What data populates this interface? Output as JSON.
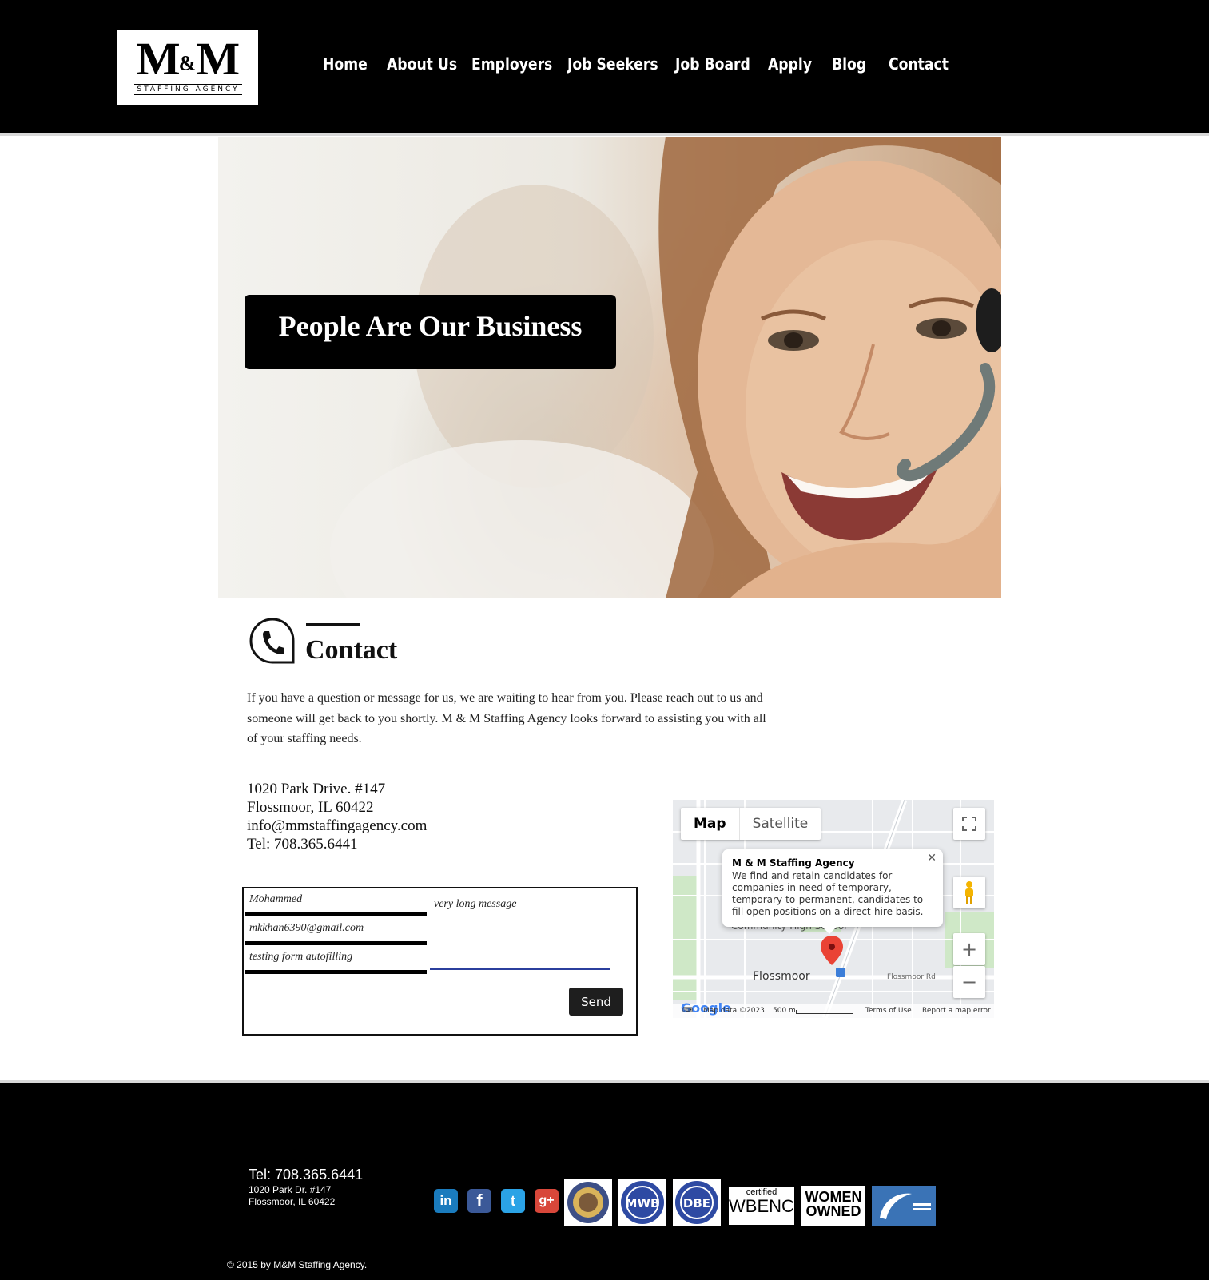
{
  "header": {
    "logo": {
      "mark": "M&M",
      "tagline": "STAFFING AGENCY"
    },
    "nav": [
      "Home",
      "About Us",
      "Employers",
      "Job Seekers",
      "Job Board",
      "Apply",
      "Blog",
      "Contact"
    ]
  },
  "hero": {
    "title": "People Are Our Business"
  },
  "contact": {
    "title": "Contact",
    "intro": "If you have a question or message for us, we are waiting to hear from you. Please reach out to us and someone will get back to you shortly. M & M Staffing Agency looks forward to assisting you with all of your staffing needs.",
    "address": [
      "1020 Park Drive. #147",
      "Flossmoor, IL 60422",
      "info@mmstaffingagency.com",
      "Tel: 708.365.6441"
    ]
  },
  "form": {
    "name_value": "Mohammed",
    "email_value": "mkkhan6390@gmail.com",
    "subject_value": "testing form autofilling",
    "message_value": "very long message",
    "send_label": "Send"
  },
  "map": {
    "tabs": [
      "Map",
      "Satellite"
    ],
    "info_title": "M & M Staffing Agency",
    "info_body": "We find and retain candidates for companies in need of temporary, temporary-to-permanent, candidates to fill open positions on a direct-hire basis.",
    "place_label": "Flossmoor",
    "school_label": "Community High School",
    "road_label": "Flossmoor Rd",
    "map_data": "Map data ©2023",
    "scale": "500 m",
    "terms": "Terms of Use",
    "report": "Report a map error",
    "google": "Google"
  },
  "footer": {
    "tel": "Tel: 708.365.6441",
    "address": [
      "1020 Park Dr. #147",
      "Flossmoor, IL 60422"
    ],
    "social": [
      "in",
      "f",
      "t",
      "g+"
    ],
    "badges": [
      "MWB",
      "DBE",
      "certified",
      "WBENC",
      "WOMEN",
      "OWNED"
    ],
    "copyright": "© 2015 by M&M Staffing Agency."
  }
}
